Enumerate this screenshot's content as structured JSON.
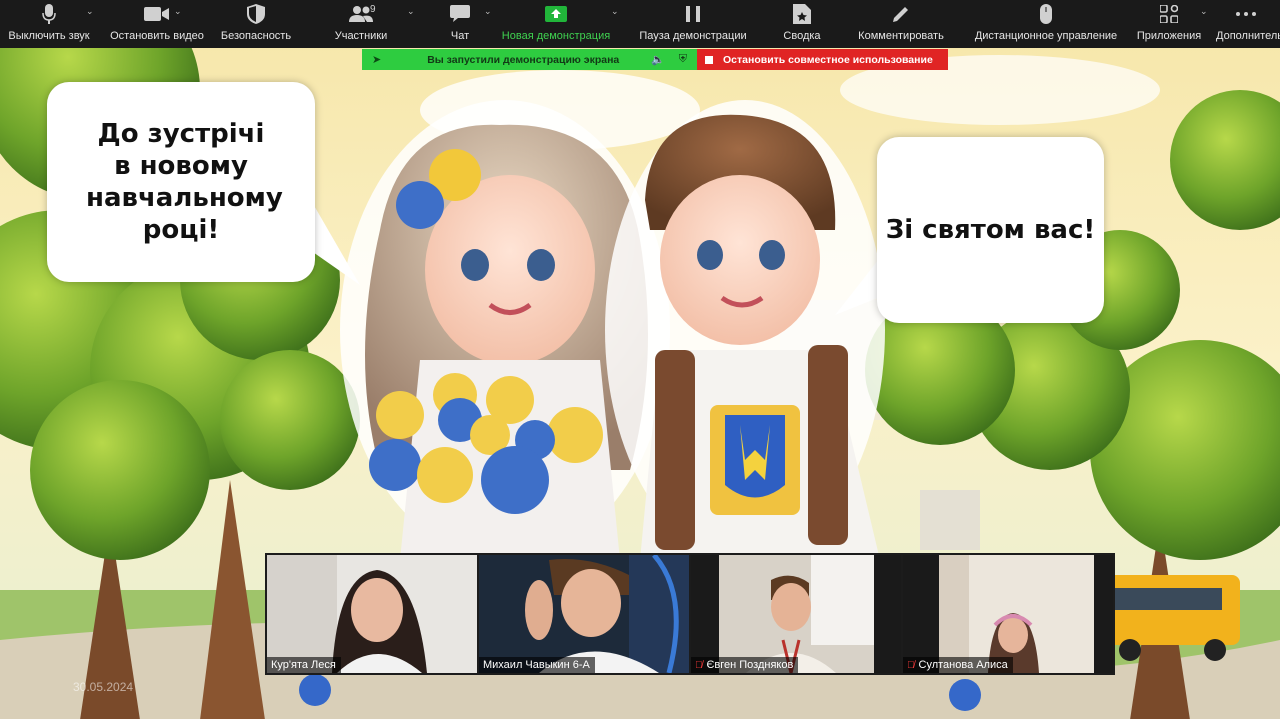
{
  "toolbar": {
    "items": [
      {
        "label": "Выключить звук",
        "icon": "microphone-icon"
      },
      {
        "label": "Остановить видео",
        "icon": "video-camera-icon"
      },
      {
        "label": "Безопасность",
        "icon": "shield-icon"
      },
      {
        "label": "Участники",
        "icon": "participants-icon",
        "badge": "9"
      },
      {
        "label": "Чат",
        "icon": "chat-icon"
      },
      {
        "label": "Новая демонстрация",
        "icon": "share-screen-icon",
        "active_color": "#3fd150"
      },
      {
        "label": "Пауза демонстрации",
        "icon": "pause-icon"
      },
      {
        "label": "Сводка",
        "icon": "summary-icon"
      },
      {
        "label": "Комментировать",
        "icon": "pencil-icon"
      },
      {
        "label": "Дистанционное управление",
        "icon": "mouse-icon"
      },
      {
        "label": "Приложения",
        "icon": "apps-icon"
      },
      {
        "label": "Дополнительно",
        "icon": "more-icon"
      }
    ]
  },
  "share_banner": {
    "status_text": "Вы запустили демонстрацию экрана",
    "stop_label": "Остановить совместное использование",
    "status_color": "#2ecc40",
    "stop_color": "#e02424"
  },
  "slide": {
    "bubble_left": "До зустрічі в новому навчальному році!",
    "bubble_right": "Зі святом вас!"
  },
  "participants": [
    {
      "name": "Кур'ята Леся",
      "muted": false
    },
    {
      "name": "Михаил Чавыкин 6-А",
      "muted": false
    },
    {
      "name": "Євген Поздняков",
      "muted": true
    },
    {
      "name": "Султанова Алиса",
      "muted": true
    }
  ],
  "date_stamp": "30.05.2024"
}
